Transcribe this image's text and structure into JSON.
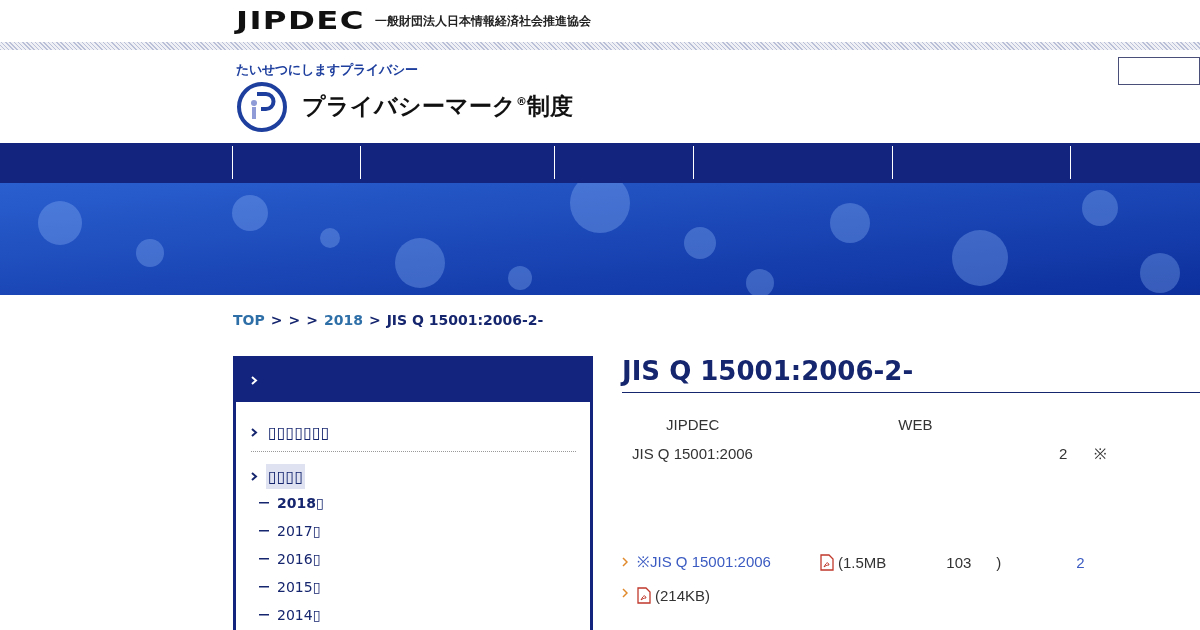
{
  "header": {
    "org_logo": "JIPDEC",
    "org_name": "一般財団法人日本情報経済社会推進協会",
    "site_logo_arc": "たいせつにしますプライバシー",
    "site_logo": "プライバシーマーク",
    "site_logo_mark": "®",
    "site_logo_suffix": "制度"
  },
  "breadcrumb": [
    {
      "label": "TOP",
      "kind": "link"
    },
    {
      "label": ">",
      "kind": "sep"
    },
    {
      "label": ">",
      "kind": "sep"
    },
    {
      "label": ">",
      "kind": "sep"
    },
    {
      "label": "2018",
      "kind": "link"
    },
    {
      "label": ">",
      "kind": "sep"
    },
    {
      "label": "JIS Q 15001:2006-2-",
      "kind": "current"
    }
  ],
  "sidebar": {
    "items": [
      {
        "label": "▯▯▯▯▯▯▯",
        "selected": false
      },
      {
        "label": "▯▯▯▯",
        "selected": true,
        "children": [
          {
            "label": "2018▯",
            "selected": true
          },
          {
            "label": "2017▯",
            "selected": false
          },
          {
            "label": "2016▯",
            "selected": false
          },
          {
            "label": "2015▯",
            "selected": false
          },
          {
            "label": "2014▯",
            "selected": false
          }
        ]
      }
    ]
  },
  "main": {
    "title": "JIS Q 15001:2006-2-",
    "rows": [
      {
        "kind": "text",
        "cells": [
          {
            "kind": "text",
            "text": "JIPDEC"
          },
          {
            "kind": "text",
            "text": "WEB"
          }
        ]
      },
      {
        "kind": "text",
        "cells": [
          {
            "kind": "text",
            "text": "JIS Q 15001:2006"
          },
          {
            "kind": "text",
            "text": "2"
          },
          {
            "kind": "text",
            "text": "※"
          }
        ]
      },
      {
        "kind": "link",
        "cells": [
          {
            "kind": "link",
            "text": "※JIS Q 15001:2006"
          },
          {
            "kind": "pdf",
            "text": "(1.5MB"
          },
          {
            "kind": "text",
            "text": "103"
          },
          {
            "kind": "text",
            "text": ")"
          },
          {
            "kind": "link",
            "text": "2"
          }
        ]
      },
      {
        "kind": "link",
        "cells": [
          {
            "kind": "pdf",
            "text": "(214KB)"
          }
        ]
      }
    ]
  }
}
